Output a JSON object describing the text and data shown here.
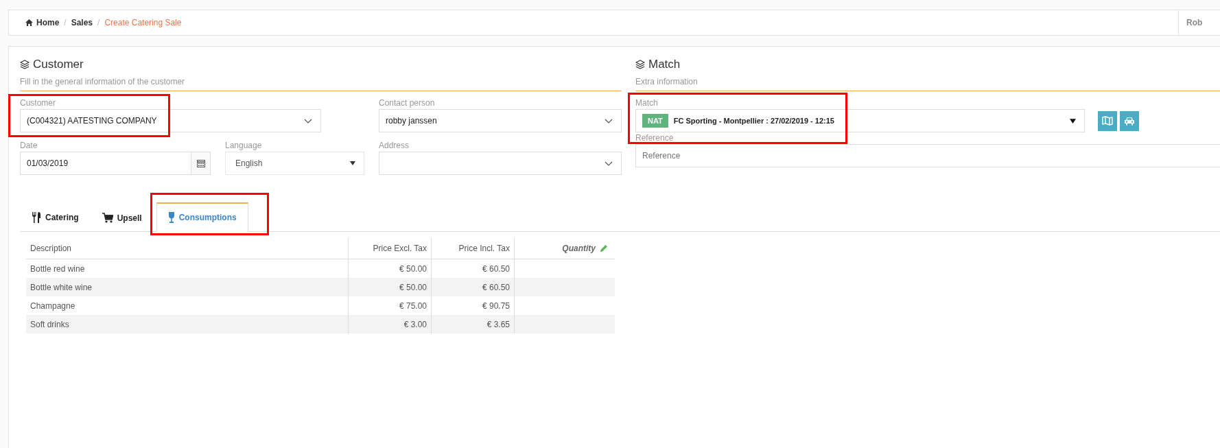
{
  "breadcrumb": [
    {
      "label": "Home",
      "current": false
    },
    {
      "separator": "/",
      "label": "Sales",
      "current": false
    },
    {
      "separator": "/",
      "label": "Create Catering Sale",
      "current": true
    }
  ],
  "user": {
    "name": "Rob"
  },
  "customer_section": {
    "title": "Customer",
    "subtitle": "Fill in the general information of the customer",
    "customer": {
      "label": "Customer",
      "value": "(C004321) AATESTING COMPANY"
    },
    "contact_person": {
      "label": "Contact person",
      "value": "robby janssen"
    },
    "date": {
      "label": "Date",
      "value": "01/03/2019"
    },
    "language": {
      "label": "Language",
      "value": "English"
    },
    "address": {
      "label": "Address"
    }
  },
  "match_section": {
    "title": "Match",
    "subtitle": "Extra information",
    "match": {
      "label": "Match",
      "badge": "NAT",
      "value": "FC Sporting - Montpellier : 27/02/2019 - 12:15"
    },
    "reference": {
      "label": "Reference",
      "placeholder": "Reference"
    }
  },
  "tabs": [
    {
      "label": "Catering",
      "selected": false
    },
    {
      "label": "Upsell",
      "selected": false
    },
    {
      "label": "Consumptions",
      "selected": true
    }
  ],
  "table": {
    "columns": [
      "Description",
      "Price Excl. Tax",
      "Price Incl. Tax",
      "Quantity"
    ],
    "rows": [
      [
        "Bottle red wine",
        "€ 50.00",
        "€ 60.50"
      ],
      [
        "Bottle white wine",
        "€ 50.00",
        "€ 60.50"
      ],
      [
        "Champagne",
        "€ 75.00",
        "€ 90.75"
      ],
      [
        "Soft drinks",
        "€ 3.00",
        "€ 3.65"
      ]
    ]
  }
}
